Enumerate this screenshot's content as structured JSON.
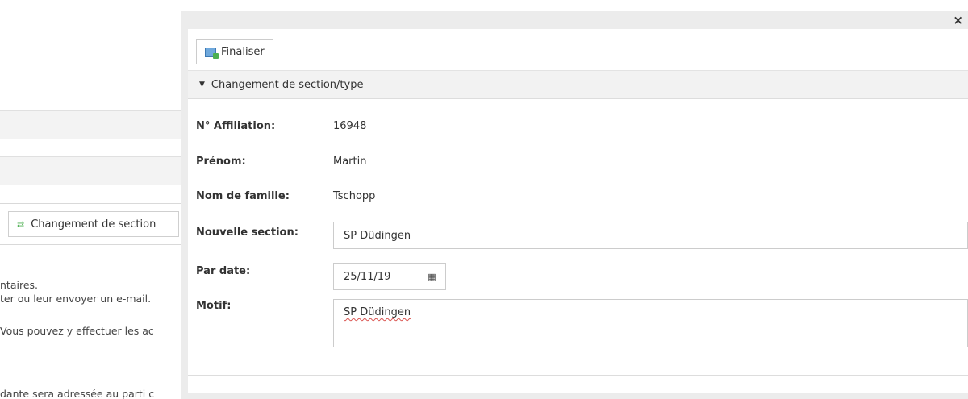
{
  "background": {
    "change_section_button": "Changement de section",
    "text_lines": [
      "ntaires.",
      "ter ou leur envoyer un e-mail.",
      "Vous pouvez y effectuer les ac",
      "dante sera adressée au parti c"
    ]
  },
  "modal": {
    "close_glyph": "×",
    "toolbar": {
      "finalize_label": "Finaliser"
    },
    "section_title": "Changement de section/type",
    "fields": {
      "affiliation_label": "N° Affiliation:",
      "affiliation_value": "16948",
      "firstname_label": "Prénom:",
      "firstname_value": "Martin",
      "lastname_label": "Nom de famille:",
      "lastname_value": "Tschopp",
      "new_section_label": "Nouvelle section:",
      "new_section_value": "SP Düdingen",
      "date_label": "Par date:",
      "date_value": "25/11/19",
      "reason_label": "Motif:",
      "reason_value": "SP Düdingen"
    }
  }
}
